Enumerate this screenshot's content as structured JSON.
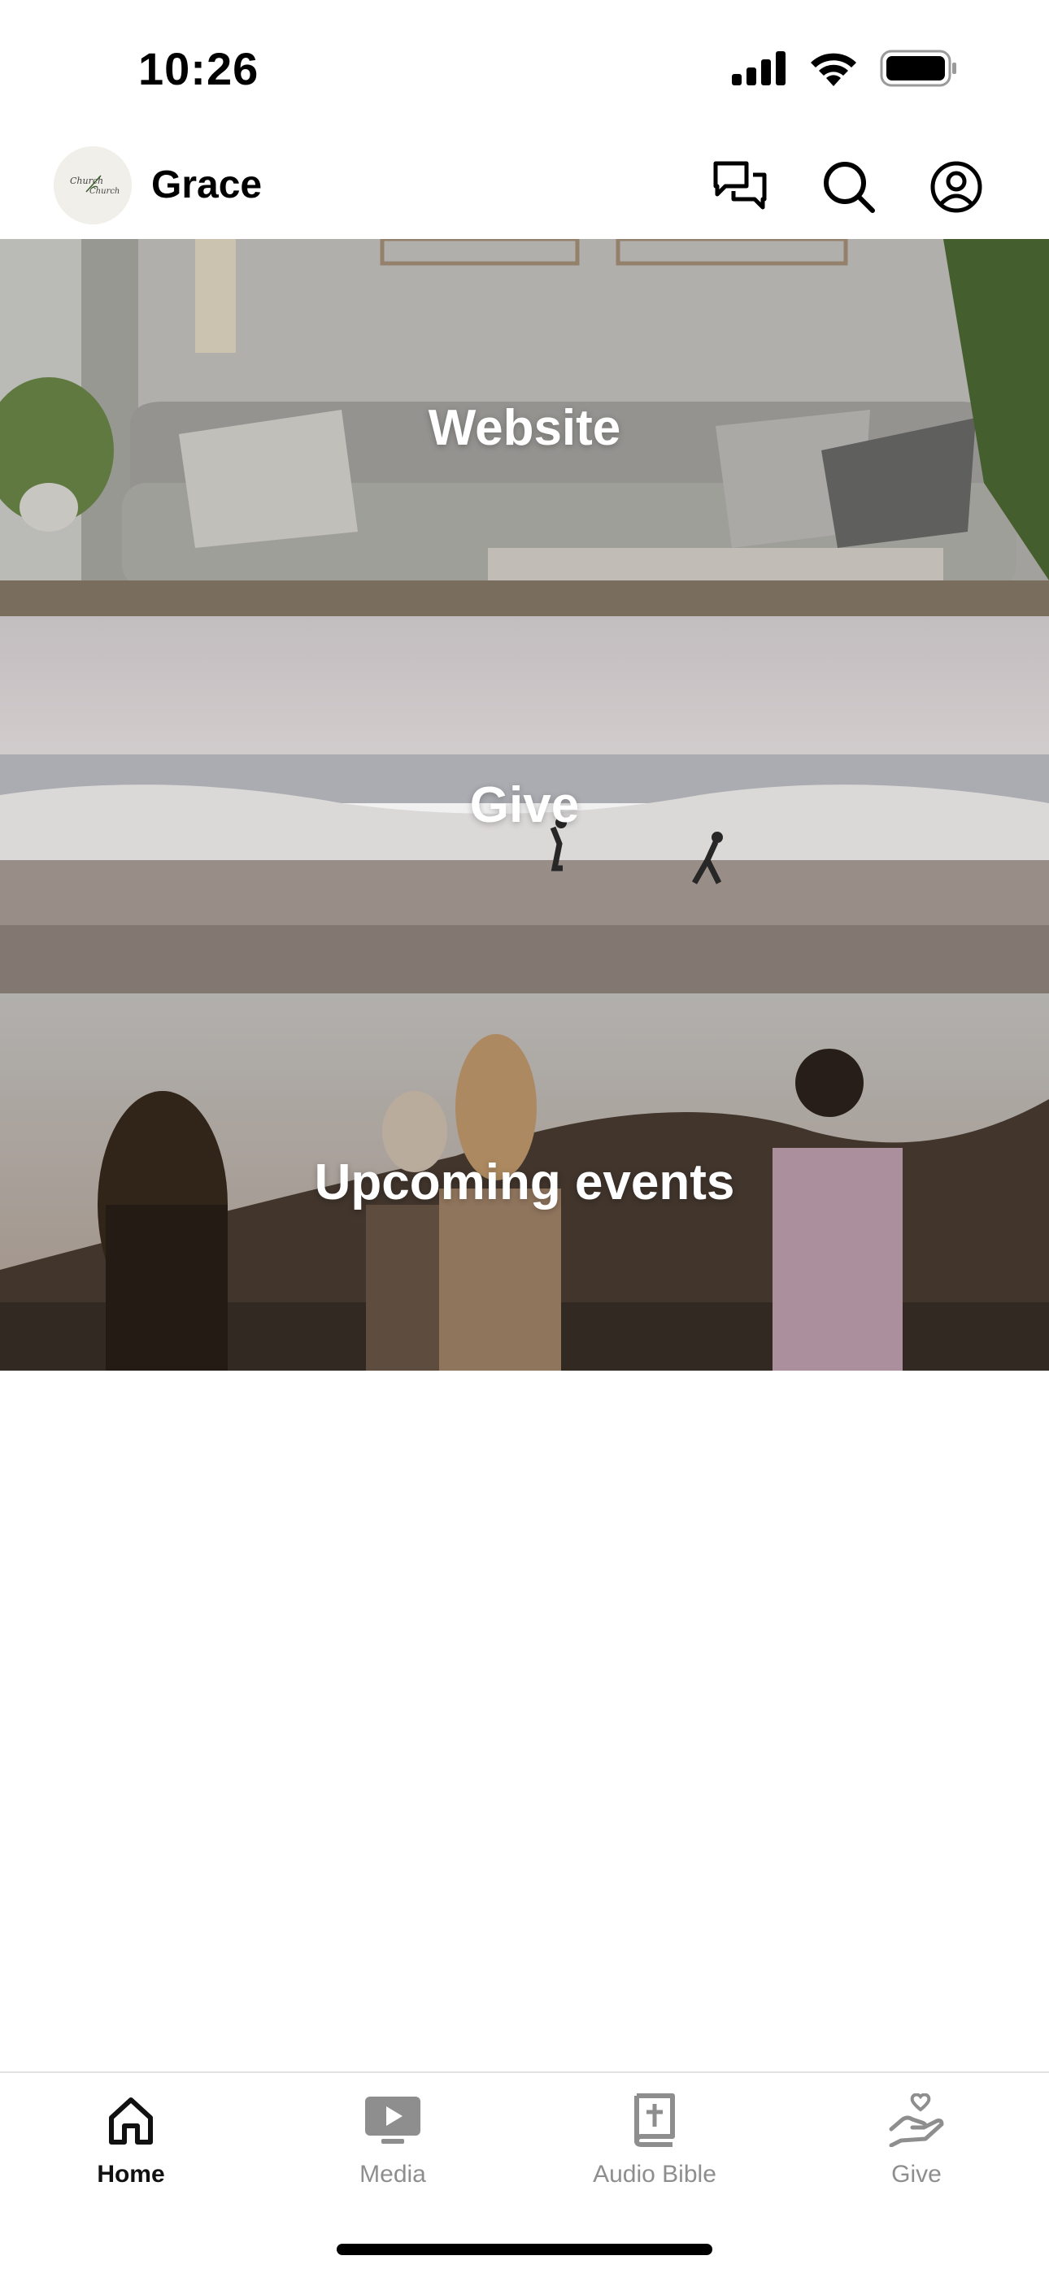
{
  "status_bar": {
    "time": "10:26",
    "icons": [
      "cellular-signal-icon",
      "wifi-icon",
      "battery-icon"
    ]
  },
  "header": {
    "logo_text": "Church of the Church",
    "title": "Grace",
    "actions": [
      "chat-icon",
      "search-icon",
      "account-icon"
    ]
  },
  "tiles": [
    {
      "label": "Website"
    },
    {
      "label": "Give"
    },
    {
      "label": "Upcoming events"
    }
  ],
  "tab_bar": {
    "tabs": [
      {
        "label": "Home",
        "icon": "home-icon",
        "active": true
      },
      {
        "label": "Media",
        "icon": "media-play-icon",
        "active": false
      },
      {
        "label": "Audio Bible",
        "icon": "bible-icon",
        "active": false
      },
      {
        "label": "Give",
        "icon": "give-hand-heart-icon",
        "active": false
      }
    ]
  },
  "colors": {
    "active_tab": "#111111",
    "inactive_tab": "#8e8e8e",
    "tile_text": "#ffffff"
  }
}
